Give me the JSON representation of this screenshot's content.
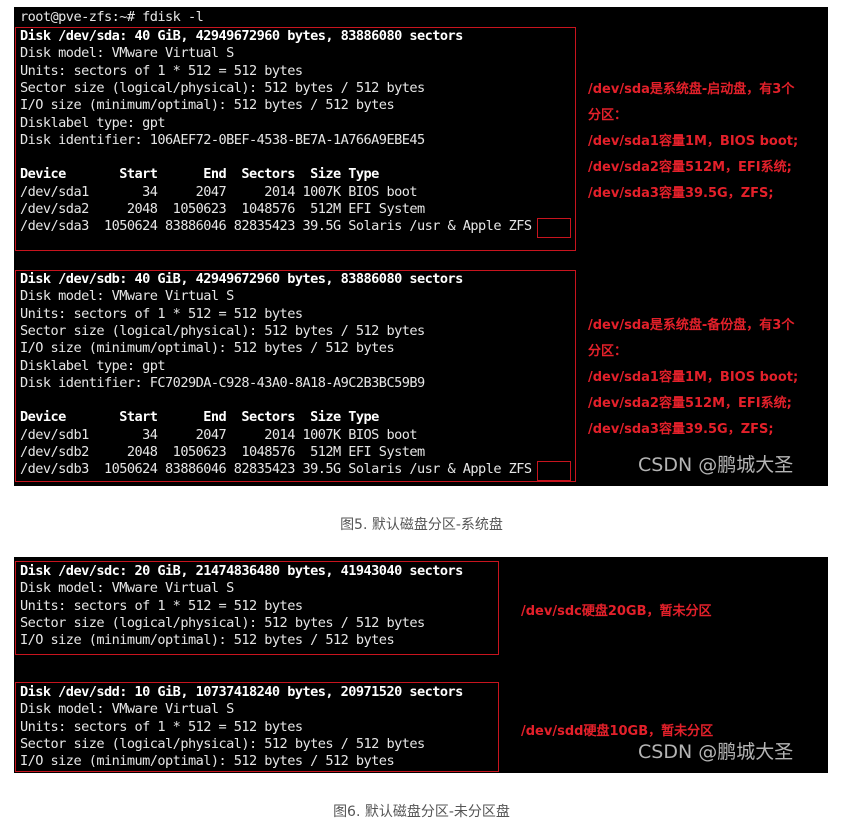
{
  "figure5": {
    "prompt": "root@pve-zfs:~# fdisk -l",
    "disk_sda": {
      "header": "Disk /dev/sda: 40 GiB, 42949672960 bytes, 83886080 sectors",
      "lines": [
        "Disk model: VMware Virtual S",
        "Units: sectors of 1 * 512 = 512 bytes",
        "Sector size (logical/physical): 512 bytes / 512 bytes",
        "I/O size (minimum/optimal): 512 bytes / 512 bytes",
        "Disklabel type: gpt",
        "Disk identifier: 106AEF72-0BEF-4538-BE7A-1A766A9EBE45"
      ],
      "table_header": "Device       Start      End  Sectors  Size Type",
      "rows": [
        "/dev/sda1       34     2047     2014 1007K BIOS boot",
        "/dev/sda2     2048  1050623  1048576  512M EFI System",
        "/dev/sda3  1050624 83886046 82835423 39.5G Solaris /usr & Apple ZFS"
      ],
      "notes": [
        "/dev/sda是系统盘-启动盘，有3个",
        "分区：",
        "/dev/sda1容量1M，BIOS boot;",
        "/dev/sda2容量512M，EFI系统;",
        "/dev/sda3容量39.5G，ZFS;"
      ]
    },
    "disk_sdb": {
      "header": "Disk /dev/sdb: 40 GiB, 42949672960 bytes, 83886080 sectors",
      "lines": [
        "Disk model: VMware Virtual S",
        "Units: sectors of 1 * 512 = 512 bytes",
        "Sector size (logical/physical): 512 bytes / 512 bytes",
        "I/O size (minimum/optimal): 512 bytes / 512 bytes",
        "Disklabel type: gpt",
        "Disk identifier: FC7029DA-C928-43A0-8A18-A9C2B3BC59B9"
      ],
      "table_header": "Device       Start      End  Sectors  Size Type",
      "rows": [
        "/dev/sdb1       34     2047     2014 1007K BIOS boot",
        "/dev/sdb2     2048  1050623  1048576  512M EFI System",
        "/dev/sdb3  1050624 83886046 82835423 39.5G Solaris /usr & Apple ZFS"
      ],
      "notes": [
        "/dev/sda是系统盘-备份盘，有3个",
        "分区：",
        "/dev/sda1容量1M，BIOS boot;",
        "/dev/sda2容量512M，EFI系统;",
        "/dev/sda3容量39.5G，ZFS;"
      ]
    },
    "watermark": "CSDN @鹏城大圣",
    "caption": "图5. 默认磁盘分区-系统盘"
  },
  "figure6": {
    "disk_sdc": {
      "header": "Disk /dev/sdc: 20 GiB, 21474836480 bytes, 41943040 sectors",
      "lines": [
        "Disk model: VMware Virtual S",
        "Units: sectors of 1 * 512 = 512 bytes",
        "Sector size (logical/physical): 512 bytes / 512 bytes",
        "I/O size (minimum/optimal): 512 bytes / 512 bytes"
      ],
      "note": "/dev/sdc硬盘20GB，暂未分区"
    },
    "disk_sdd": {
      "header": "Disk /dev/sdd: 10 GiB, 10737418240 bytes, 20971520 sectors",
      "lines": [
        "Disk model: VMware Virtual S",
        "Units: sectors of 1 * 512 = 512 bytes",
        "Sector size (logical/physical): 512 bytes / 512 bytes",
        "I/O size (minimum/optimal): 512 bytes / 512 bytes"
      ],
      "note": "/dev/sdd硬盘10GB，暂未分区"
    },
    "watermark": "CSDN @鹏城大圣",
    "caption": "图6. 默认磁盘分区-未分区盘"
  },
  "colors": {
    "terminal_bg": "#000000",
    "terminal_text": "#e6e6e6",
    "highlight_border": "#c8141e",
    "annotation_text": "#e3202a",
    "caption_text": "#555555"
  }
}
